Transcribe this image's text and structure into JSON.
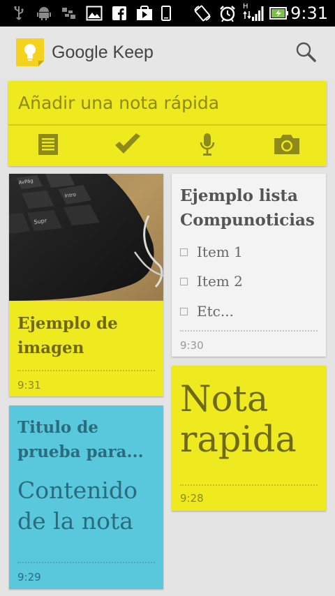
{
  "status_bar": {
    "time": "9:31",
    "icons_left": [
      "usb-icon",
      "android-icon",
      "sync-icon",
      "image-icon",
      "facebook-icon",
      "play-store-icon",
      "phone-icon"
    ],
    "icons_right": [
      "rotate-icon",
      "alarm-icon",
      "signal-icon",
      "battery-icon"
    ],
    "signal_label": "H"
  },
  "app": {
    "title": "Google Keep",
    "accent_color": "#eeea1f"
  },
  "quick_note": {
    "placeholder": "Añadir una nota rápida",
    "actions": [
      "text-note",
      "checklist",
      "voice-note",
      "photo-note"
    ]
  },
  "notes": [
    {
      "type": "image",
      "title": "Ejemplo de imagen",
      "time": "9:31",
      "color": "#eeea1f"
    },
    {
      "type": "list",
      "title": "Ejemplo lista Compunoticias",
      "items": [
        "Item 1",
        "Item 2",
        "Etc..."
      ],
      "time": "9:30",
      "color": "#f3f3f3"
    },
    {
      "type": "text",
      "body": "Nota rapida",
      "time": "9:28",
      "color": "#eeea1f"
    },
    {
      "type": "text",
      "title": "Titulo de prueba para...",
      "body": "Contenido de la nota",
      "time": "9:29",
      "color": "#5ac8dc"
    }
  ]
}
